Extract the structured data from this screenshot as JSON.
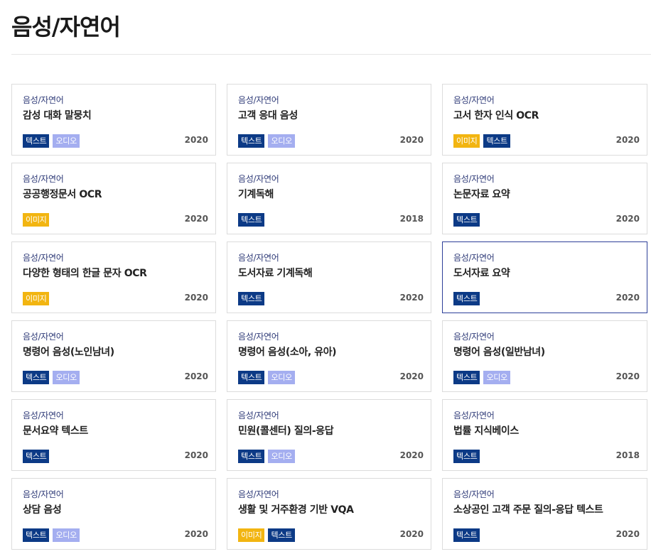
{
  "header": {
    "title": "음성/자연어"
  },
  "colors": {
    "text_tag": "#0c3a86",
    "audio_tag": "#a4aef0",
    "image_tag": "#f2b511",
    "active_border": "#2d3f99"
  },
  "cards": [
    {
      "category": "음성/자연어",
      "title": "감성 대화 말뭉치",
      "tags": [
        {
          "label": "텍스트",
          "type": "text"
        },
        {
          "label": "오디오",
          "type": "audio"
        }
      ],
      "year": "2020"
    },
    {
      "category": "음성/자연어",
      "title": "고객 응대 음성",
      "tags": [
        {
          "label": "텍스트",
          "type": "text"
        },
        {
          "label": "오디오",
          "type": "audio"
        }
      ],
      "year": "2020"
    },
    {
      "category": "음성/자연어",
      "title": "고서 한자 인식 OCR",
      "tags": [
        {
          "label": "이미지",
          "type": "image"
        },
        {
          "label": "텍스트",
          "type": "text"
        }
      ],
      "year": "2020"
    },
    {
      "category": "음성/자연어",
      "title": "공공행정문서 OCR",
      "tags": [
        {
          "label": "이미지",
          "type": "image"
        }
      ],
      "year": "2020"
    },
    {
      "category": "음성/자연어",
      "title": "기계독해",
      "tags": [
        {
          "label": "텍스트",
          "type": "text"
        }
      ],
      "year": "2018"
    },
    {
      "category": "음성/자연어",
      "title": "논문자료 요약",
      "tags": [
        {
          "label": "텍스트",
          "type": "text"
        }
      ],
      "year": "2020"
    },
    {
      "category": "음성/자연어",
      "title": "다양한 형태의 한글 문자 OCR",
      "tags": [
        {
          "label": "이미지",
          "type": "image"
        }
      ],
      "year": "2020"
    },
    {
      "category": "음성/자연어",
      "title": "도서자료 기계독해",
      "tags": [
        {
          "label": "텍스트",
          "type": "text"
        }
      ],
      "year": "2020"
    },
    {
      "category": "음성/자연어",
      "title": "도서자료 요약",
      "tags": [
        {
          "label": "텍스트",
          "type": "text"
        }
      ],
      "year": "2020",
      "active": true
    },
    {
      "category": "음성/자연어",
      "title": "명령어 음성(노인남녀)",
      "tags": [
        {
          "label": "텍스트",
          "type": "text"
        },
        {
          "label": "오디오",
          "type": "audio"
        }
      ],
      "year": "2020"
    },
    {
      "category": "음성/자연어",
      "title": "명령어 음성(소아, 유아)",
      "tags": [
        {
          "label": "텍스트",
          "type": "text"
        },
        {
          "label": "오디오",
          "type": "audio"
        }
      ],
      "year": "2020"
    },
    {
      "category": "음성/자연어",
      "title": "명령어 음성(일반남녀)",
      "tags": [
        {
          "label": "텍스트",
          "type": "text"
        },
        {
          "label": "오디오",
          "type": "audio"
        }
      ],
      "year": "2020"
    },
    {
      "category": "음성/자연어",
      "title": "문서요약 텍스트",
      "tags": [
        {
          "label": "텍스트",
          "type": "text"
        }
      ],
      "year": "2020"
    },
    {
      "category": "음성/자연어",
      "title": "민원(콜센터) 질의-응답",
      "tags": [
        {
          "label": "텍스트",
          "type": "text"
        },
        {
          "label": "오디오",
          "type": "audio"
        }
      ],
      "year": "2020"
    },
    {
      "category": "음성/자연어",
      "title": "법률 지식베이스",
      "tags": [
        {
          "label": "텍스트",
          "type": "text"
        }
      ],
      "year": "2018"
    },
    {
      "category": "음성/자연어",
      "title": "상담 음성",
      "tags": [
        {
          "label": "텍스트",
          "type": "text"
        },
        {
          "label": "오디오",
          "type": "audio"
        }
      ],
      "year": "2020"
    },
    {
      "category": "음성/자연어",
      "title": "생활 및 거주환경 기반 VQA",
      "tags": [
        {
          "label": "이미지",
          "type": "image"
        },
        {
          "label": "텍스트",
          "type": "text"
        }
      ],
      "year": "2020"
    },
    {
      "category": "음성/자연어",
      "title": "소상공인 고객 주문 질의-응답 텍스트",
      "tags": [
        {
          "label": "텍스트",
          "type": "text"
        }
      ],
      "year": "2020"
    }
  ]
}
